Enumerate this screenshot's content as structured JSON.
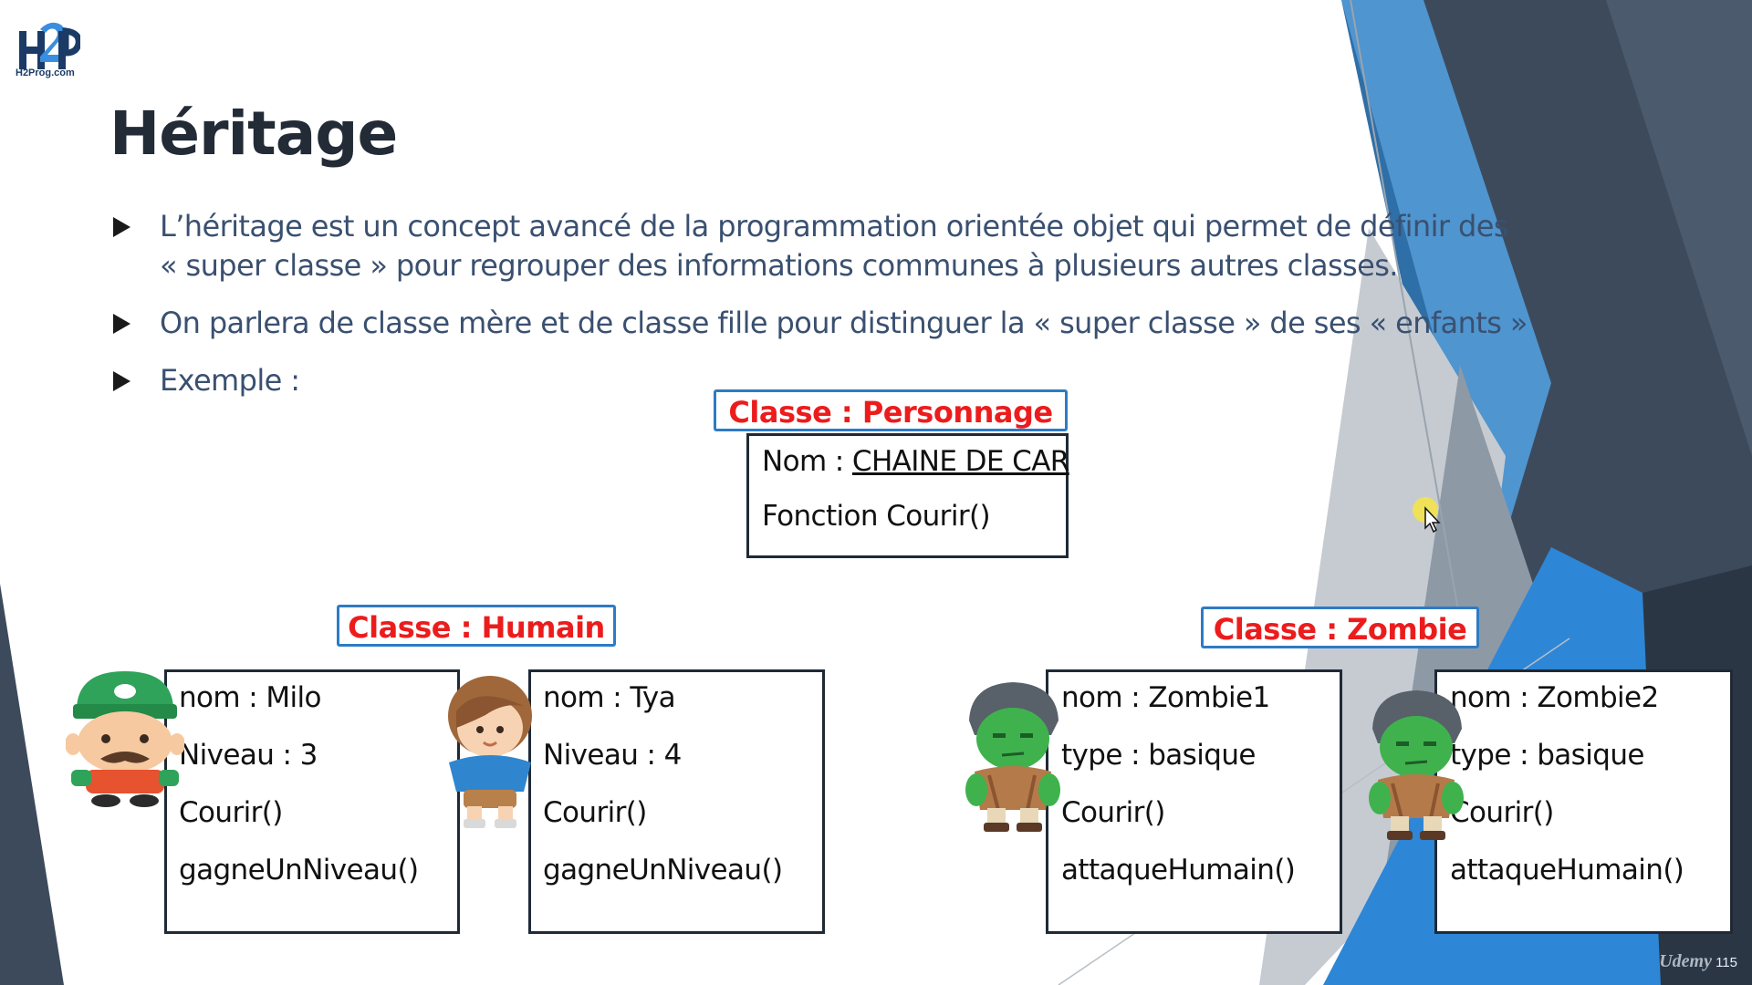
{
  "logo": {
    "caption": "H2Prog.com"
  },
  "slide": {
    "title": "Héritage",
    "bullets": [
      {
        "lines": [
          "L’héritage est un concept avancé de la programmation orientée objet qui permet de définir des",
          "« super classe » pour regrouper des informations communes à plusieurs autres classes."
        ]
      },
      {
        "lines": [
          "On parlera de classe mère et de classe fille pour distinguer la « super classe » de ses « enfants »"
        ]
      },
      {
        "lines": [
          "Exemple :"
        ]
      }
    ],
    "number": "115",
    "watermark": "Udemy"
  },
  "diagram": {
    "personnage": {
      "tag": "Classe : Personnage",
      "nom_label": "Nom : ",
      "nom_type": "CHAINE DE CAR",
      "fonction": "Fonction Courir()"
    },
    "humain": {
      "tag": "Classe : Humain",
      "instances": [
        {
          "nom": "nom : Milo",
          "niveau": "Niveau : 3",
          "m1": "Courir()",
          "m2": "gagneUnNiveau()"
        },
        {
          "nom": "nom : Tya",
          "niveau": "Niveau : 4",
          "m1": "Courir()",
          "m2": "gagneUnNiveau()"
        }
      ]
    },
    "zombie": {
      "tag": "Classe : Zombie",
      "instances": [
        {
          "nom": "nom : Zombie1",
          "type": "type : basique",
          "m1": "Courir()",
          "m2": "attaqueHumain()"
        },
        {
          "nom": "nom : Zombie2",
          "type": "type : basique",
          "m1": "Courir()",
          "m2": "attaqueHumain()"
        }
      ]
    }
  },
  "colors": {
    "tag_text": "#ec1c1c",
    "tag_border": "#2e7bc4",
    "bullet_text": "#3a5070",
    "title": "#222b36"
  }
}
